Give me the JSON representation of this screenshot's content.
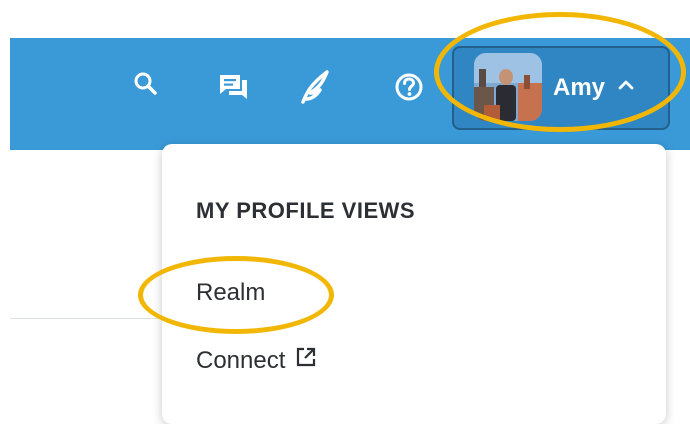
{
  "header": {
    "icons": [
      "search-icon",
      "chat-icon",
      "feather-icon",
      "help-icon"
    ]
  },
  "profile": {
    "name": "Amy",
    "caret_icon": "chevron-up-icon",
    "avatar": "user-avatar-photo"
  },
  "menu": {
    "heading": "MY PROFILE VIEWS",
    "items": [
      {
        "label": "Realm"
      },
      {
        "label": "Connect",
        "icon": "external-link-icon"
      }
    ]
  },
  "colors": {
    "header_bg": "#3a9ad8",
    "profile_bg": "#2f86c2",
    "annotation": "#f2b705",
    "text": "#2c2f33"
  }
}
